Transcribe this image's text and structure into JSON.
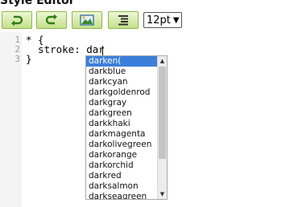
{
  "window": {
    "title": "Style Editor"
  },
  "toolbar": {
    "buttons": [
      {
        "icon": "undo-arrow-icon"
      },
      {
        "icon": "redo-arrow-icon"
      },
      {
        "icon": "image-icon"
      },
      {
        "icon": "format-lines-icon"
      }
    ],
    "font_size": "12pt",
    "font_size_arrow": "▼"
  },
  "editor": {
    "line_numbers": [
      "1",
      "2",
      "3"
    ],
    "lines": [
      "* {",
      "  stroke: dar",
      "}"
    ]
  },
  "autocomplete": {
    "items": [
      "darken(",
      "darkblue",
      "darkcyan",
      "darkgoldenrod",
      "darkgray",
      "darkgreen",
      "darkkhaki",
      "darkmagenta",
      "darkolivegreen",
      "darkorange",
      "darkorchid",
      "darkred",
      "darksalmon",
      "darkseagreen"
    ],
    "selected_index": 0,
    "scroll_up": "▲",
    "scroll_down": "▼"
  },
  "colors": {
    "button_border": "#8db84a",
    "selection": "#3b7fda",
    "gutter": "#f4f4f4"
  }
}
